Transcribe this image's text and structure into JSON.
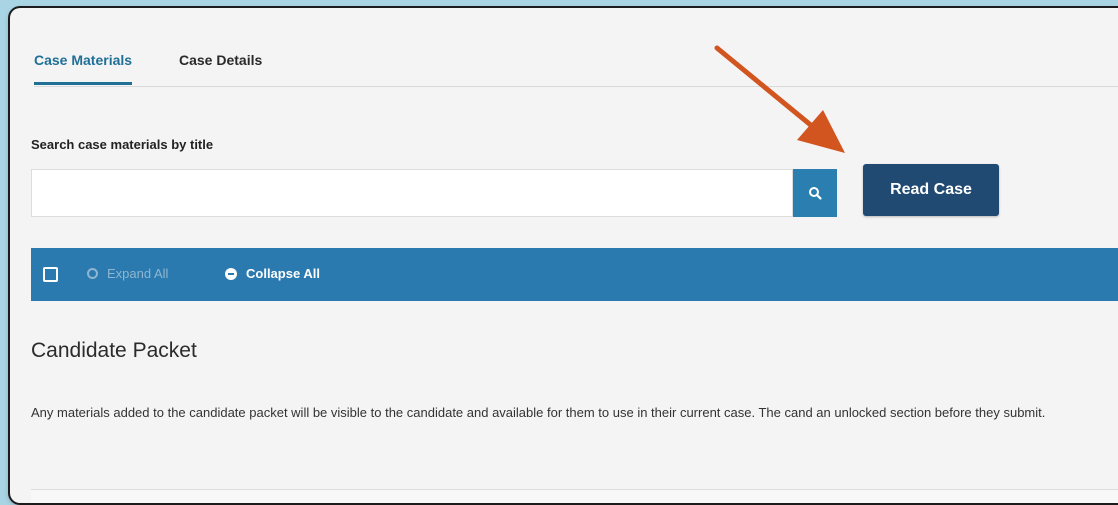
{
  "tabs": [
    {
      "label": "Case Materials",
      "active": true
    },
    {
      "label": "Case Details",
      "active": false
    }
  ],
  "search": {
    "label": "Search case materials by title",
    "value": "",
    "placeholder": "",
    "button_icon": "search-icon"
  },
  "actions": {
    "read_case_label": "Read Case"
  },
  "toolbar": {
    "expand_all_label": "Expand All",
    "collapse_all_label": "Collapse All"
  },
  "section": {
    "title": "Candidate Packet",
    "description": "Any materials added to the candidate packet will be visible to the candidate and available for them to use in their current case. The cand an unlocked section before they submit."
  },
  "colors": {
    "accent": "#2a7ab0",
    "primary_button": "#214a73",
    "annotation_arrow": "#d2541f",
    "background": "#a9d4e4"
  }
}
